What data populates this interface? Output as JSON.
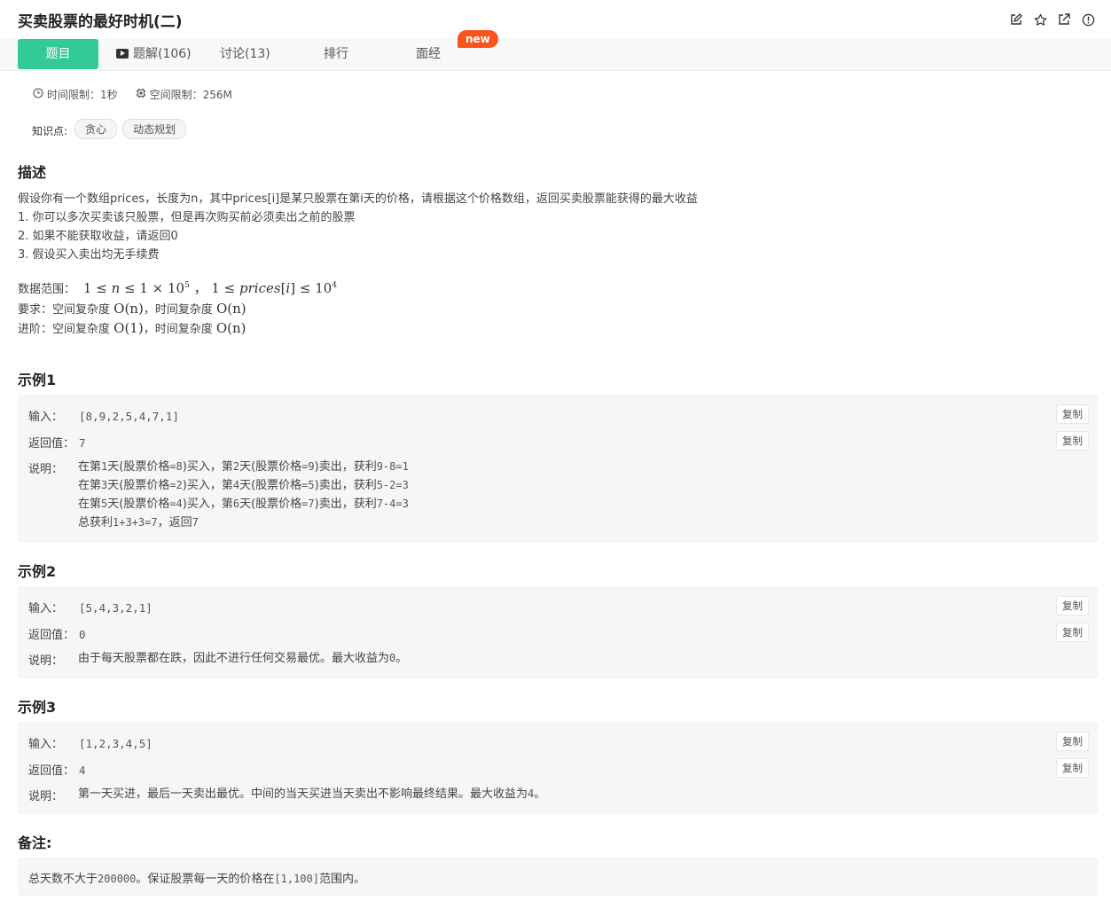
{
  "problem": {
    "title": "买卖股票的最好时机(二)"
  },
  "header_icons": [
    "edit-icon",
    "star-icon",
    "share-icon",
    "report-icon"
  ],
  "tabs": [
    {
      "label": "题目",
      "active": true
    },
    {
      "label": "题解(106)",
      "icon": "video-icon"
    },
    {
      "label": "讨论(13)"
    },
    {
      "label": "排行"
    },
    {
      "label": "面经"
    }
  ],
  "badge_new": "new",
  "meta": {
    "time_limit": "时间限制：1秒",
    "space_limit": "空间限制：256M"
  },
  "knowledge": {
    "label": "知识点:",
    "tags": [
      "贪心",
      "动态规划"
    ]
  },
  "description": {
    "heading": "描述",
    "line1": "假设你有一个数组prices，长度为n，其中prices[i]是某只股票在第i天的价格，请根据这个价格数组，返回买卖股票能获得的最大收益",
    "line2": "1. 你可以多次买卖该只股票，但是再次购买前必须卖出之前的股票",
    "line3": "2. 如果不能获取收益，请返回0",
    "line4": "3. 假设买入卖出均无手续费",
    "range_label": "数据范围：",
    "req_label": "要求：空间复杂度 ",
    "req_space": "O(n)",
    "req_mid": "，时间复杂度 ",
    "req_time": "O(n)",
    "adv_label": "进阶：空间复杂度 ",
    "adv_space": "O(1)",
    "adv_mid": "，时间复杂度 ",
    "adv_time": "O(n)"
  },
  "examples": [
    {
      "heading": "示例1",
      "input_label": "输入：",
      "input": "[8,9,2,5,4,7,1]",
      "output_label": "返回值：",
      "output": "7",
      "explain_label": "说明：",
      "explain_lines": [
        [
          "在第",
          "1",
          "天(股票价格",
          "=8",
          ")买入，第",
          "2",
          "天(股票价格",
          "=9",
          ")卖出，获利",
          "9-8=1"
        ],
        [
          "在第",
          "3",
          "天(股票价格",
          "=2",
          ")买入，第",
          "4",
          "天(股票价格",
          "=5",
          ")卖出，获利",
          "5-2=3"
        ],
        [
          "在第",
          "5",
          "天(股票价格",
          "=4",
          ")买入，第",
          "6",
          "天(股票价格",
          "=7",
          ")卖出，获利",
          "7-4=3"
        ],
        [
          "总获利",
          "1+3+3=7",
          "，返回",
          "7"
        ]
      ]
    },
    {
      "heading": "示例2",
      "input_label": "输入：",
      "input": "[5,4,3,2,1]",
      "output_label": "返回值：",
      "output": "0",
      "explain_label": "说明：",
      "explain_text": "由于每天股票都在跌，因此不进行任何交易最优。最大收益为",
      "explain_num": "0",
      "explain_end": "。"
    },
    {
      "heading": "示例3",
      "input_label": "输入：",
      "input": "[1,2,3,4,5]",
      "output_label": "返回值：",
      "output": "4",
      "explain_label": "说明：",
      "explain_text": "第一天买进，最后一天卖出最优。中间的当天买进当天卖出不影响最终结果。最大收益为",
      "explain_num": "4",
      "explain_end": "。"
    }
  ],
  "copy_label": "复制",
  "note": {
    "heading": "备注:",
    "pre": "总天数不大于",
    "num": "200000",
    "mid": "。保证股票每一天的价格在",
    "range": "[1,100]",
    "end": "范围内。"
  }
}
